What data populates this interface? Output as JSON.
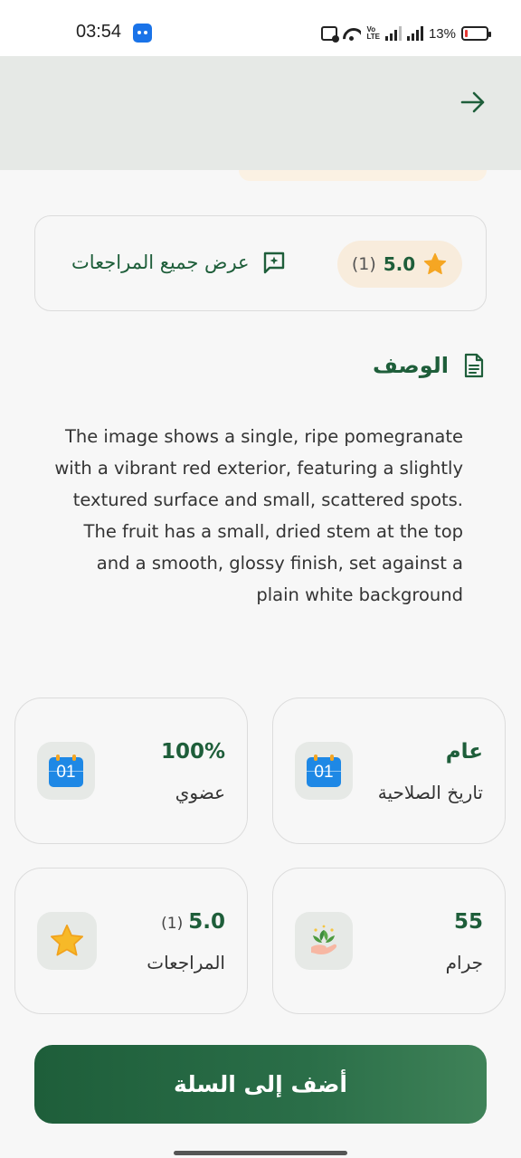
{
  "status_bar": {
    "time": "03:54",
    "volte": "Vo\nLTE",
    "battery_percent": "13%",
    "battery_level": 0.13,
    "icons": [
      "app-notification-icon",
      "card-icon",
      "wifi-icon",
      "volte-icon",
      "signal-icon",
      "signal-icon",
      "battery-icon"
    ]
  },
  "app_bar": {
    "back_icon": "arrow-right-icon"
  },
  "reviews": {
    "score": "5.0",
    "count": "(1)",
    "view_all_label": "عرض جميع المراجعات",
    "star_color": "#f5a623",
    "icon": "review-message-icon"
  },
  "description": {
    "title": "الوصف",
    "icon": "document-icon",
    "text": "The image shows a single, ripe pomegranate with a vibrant red exterior, featuring a slightly textured surface and small, scattered spots. The fruit has a small, dried stem at the top and a smooth, glossy finish, set against a plain white background"
  },
  "info_cards": {
    "expiry": {
      "value": "عام",
      "label": "تاريخ الصلاحية",
      "icon": "calendar-icon",
      "icon_text": "01"
    },
    "organic": {
      "value": "100%",
      "label": "عضوي",
      "icon": "calendar-icon",
      "icon_text": "01"
    },
    "weight": {
      "value": "55",
      "label": "جرام",
      "icon": "plant-in-hand-icon"
    },
    "reviews": {
      "value": "5.0",
      "count": "(1)",
      "label": "المراجعات",
      "icon": "star-icon"
    }
  },
  "cart_button": {
    "label": "أضف إلى السلة"
  },
  "colors": {
    "primary": "#1e5e3a",
    "appbar_bg": "#e6e9e6",
    "pill_bg": "#f8ecdc",
    "star": "#f5a623",
    "calendar": "#1e88e5"
  }
}
